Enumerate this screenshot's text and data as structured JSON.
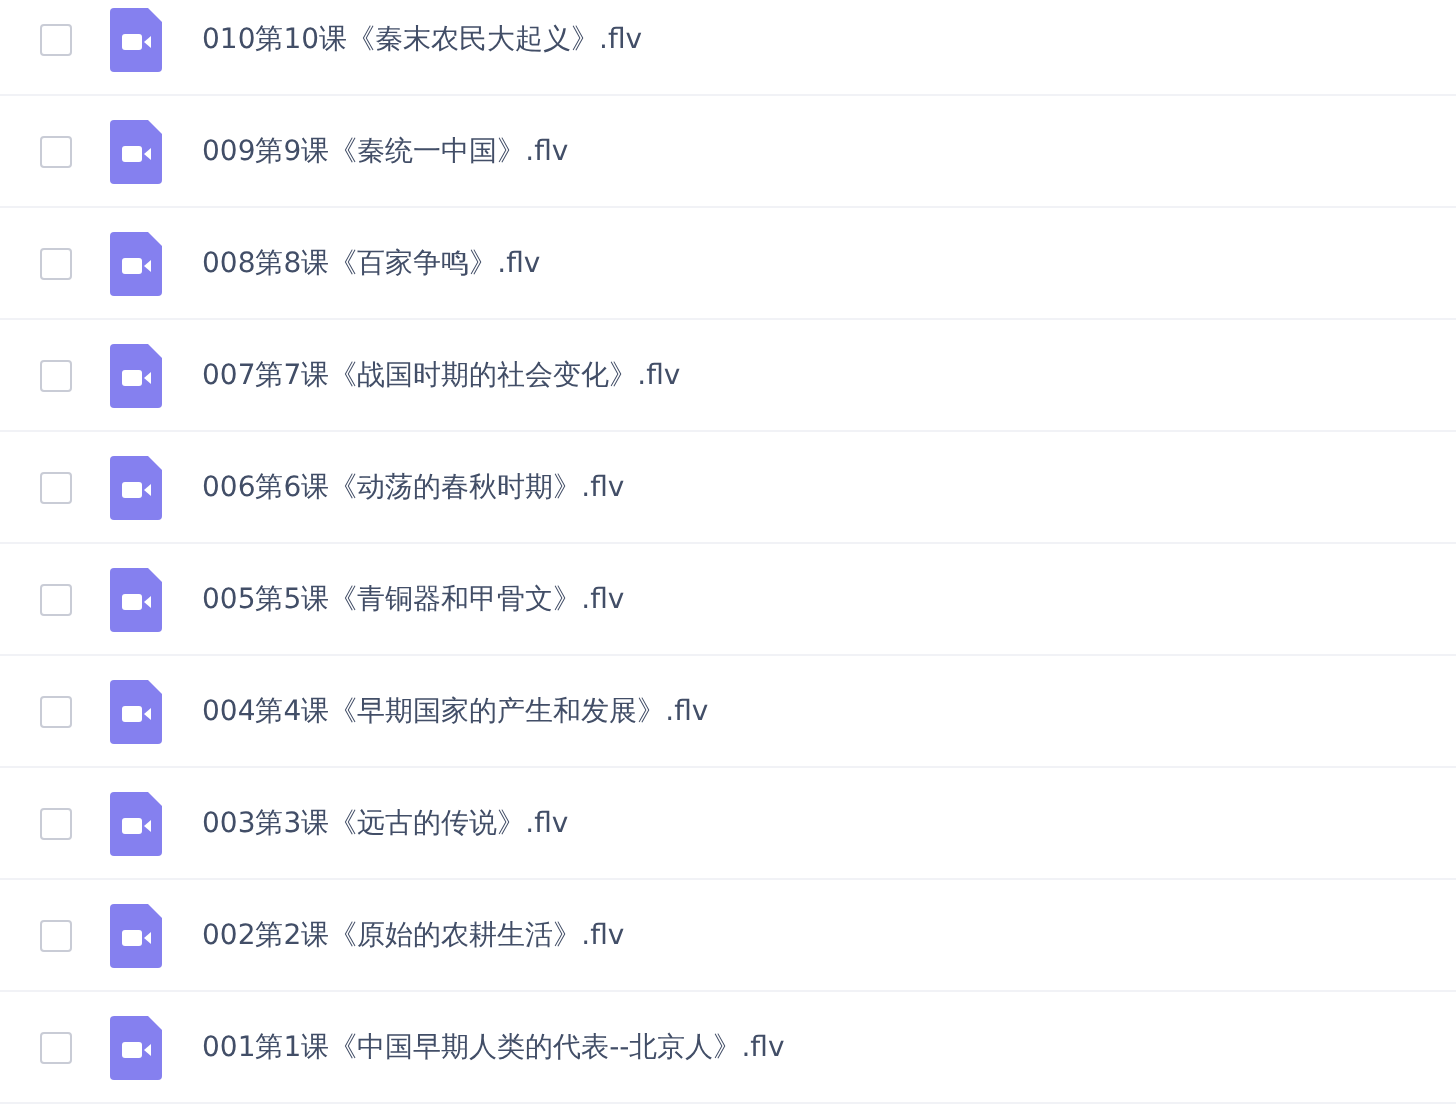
{
  "files": [
    {
      "name": "010第10课《秦末农民大起义》.flv",
      "checked": false
    },
    {
      "name": "009第9课《秦统一中国》.flv",
      "checked": false
    },
    {
      "name": "008第8课《百家争鸣》.flv",
      "checked": false
    },
    {
      "name": "007第7课《战国时期的社会变化》.flv",
      "checked": false
    },
    {
      "name": "006第6课《动荡的春秋时期》.flv",
      "checked": false
    },
    {
      "name": "005第5课《青铜器和甲骨文》.flv",
      "checked": false
    },
    {
      "name": "004第4课《早期国家的产生和发展》.flv",
      "checked": false
    },
    {
      "name": "003第3课《远古的传说》.flv",
      "checked": false
    },
    {
      "name": "002第2课《原始的农耕生活》.flv",
      "checked": false
    },
    {
      "name": "001第1课《中国早期人类的代表--北京人》.flv",
      "checked": false
    }
  ]
}
